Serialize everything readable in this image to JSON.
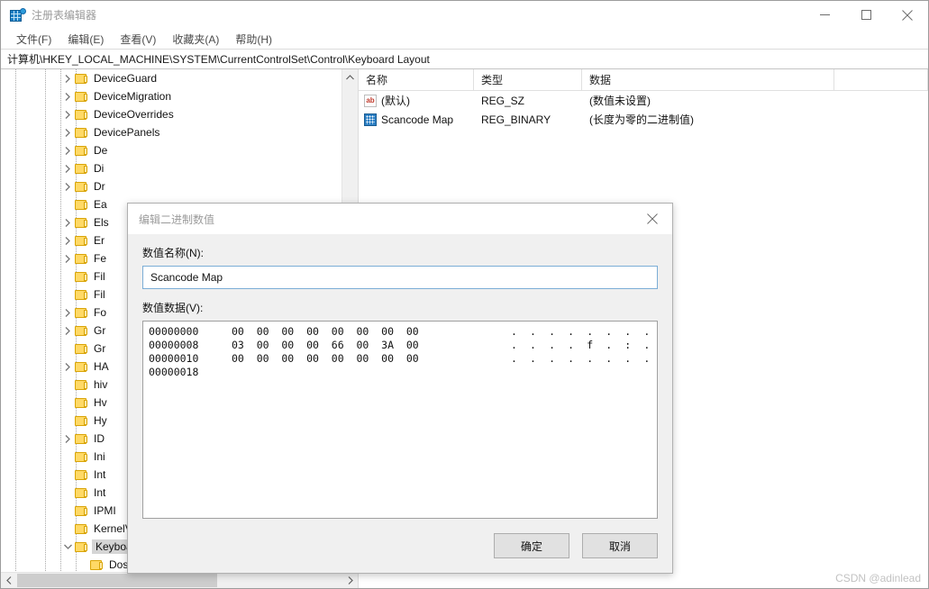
{
  "window": {
    "title": "注册表编辑器",
    "app_icon": "registry-editor-icon",
    "controls": {
      "minimize": "minimize-icon",
      "maximize": "maximize-icon",
      "close": "close-icon"
    }
  },
  "menu": {
    "items": [
      {
        "label": "文件(F)"
      },
      {
        "label": "编辑(E)"
      },
      {
        "label": "查看(V)"
      },
      {
        "label": "收藏夹(A)"
      },
      {
        "label": "帮助(H)"
      }
    ]
  },
  "address": {
    "path": "计算机\\HKEY_LOCAL_MACHINE\\SYSTEM\\CurrentControlSet\\Control\\Keyboard Layout"
  },
  "tree": {
    "items": [
      {
        "label": "DeviceGuard",
        "expandable": true,
        "expanded": false,
        "depth": 1,
        "selected": false
      },
      {
        "label": "DeviceMigration",
        "expandable": true,
        "expanded": false,
        "depth": 1,
        "selected": false
      },
      {
        "label": "DeviceOverrides",
        "expandable": true,
        "expanded": false,
        "depth": 1,
        "selected": false
      },
      {
        "label": "DevicePanels",
        "expandable": true,
        "expanded": false,
        "depth": 1,
        "selected": false
      },
      {
        "label": "De",
        "expandable": true,
        "expanded": false,
        "depth": 1,
        "selected": false
      },
      {
        "label": "Di",
        "expandable": true,
        "expanded": false,
        "depth": 1,
        "selected": false
      },
      {
        "label": "Dr",
        "expandable": true,
        "expanded": false,
        "depth": 1,
        "selected": false
      },
      {
        "label": "Ea",
        "expandable": false,
        "expanded": false,
        "depth": 1,
        "selected": false
      },
      {
        "label": "Els",
        "expandable": true,
        "expanded": false,
        "depth": 1,
        "selected": false
      },
      {
        "label": "Er",
        "expandable": true,
        "expanded": false,
        "depth": 1,
        "selected": false
      },
      {
        "label": "Fe",
        "expandable": true,
        "expanded": false,
        "depth": 1,
        "selected": false
      },
      {
        "label": "Fil",
        "expandable": false,
        "expanded": false,
        "depth": 1,
        "selected": false
      },
      {
        "label": "Fil",
        "expandable": false,
        "expanded": false,
        "depth": 1,
        "selected": false
      },
      {
        "label": "Fo",
        "expandable": true,
        "expanded": false,
        "depth": 1,
        "selected": false
      },
      {
        "label": "Gr",
        "expandable": true,
        "expanded": false,
        "depth": 1,
        "selected": false
      },
      {
        "label": "Gr",
        "expandable": false,
        "expanded": false,
        "depth": 1,
        "selected": false
      },
      {
        "label": "HA",
        "expandable": true,
        "expanded": false,
        "depth": 1,
        "selected": false
      },
      {
        "label": "hiv",
        "expandable": false,
        "expanded": false,
        "depth": 1,
        "selected": false
      },
      {
        "label": "Hv",
        "expandable": false,
        "expanded": false,
        "depth": 1,
        "selected": false
      },
      {
        "label": "Hy",
        "expandable": false,
        "expanded": false,
        "depth": 1,
        "selected": false
      },
      {
        "label": "ID",
        "expandable": true,
        "expanded": false,
        "depth": 1,
        "selected": false
      },
      {
        "label": "Ini",
        "expandable": false,
        "expanded": false,
        "depth": 1,
        "selected": false
      },
      {
        "label": "Int",
        "expandable": false,
        "expanded": false,
        "depth": 1,
        "selected": false
      },
      {
        "label": "Int",
        "expandable": false,
        "expanded": false,
        "depth": 1,
        "selected": false
      },
      {
        "label": "IPMI",
        "expandable": false,
        "expanded": false,
        "depth": 1,
        "selected": false
      },
      {
        "label": "KernelVelocity",
        "expandable": false,
        "expanded": false,
        "depth": 1,
        "selected": false
      },
      {
        "label": "Keyboard Layout",
        "expandable": true,
        "expanded": true,
        "depth": 1,
        "selected": true
      },
      {
        "label": "DosKeybCodes",
        "expandable": false,
        "expanded": false,
        "depth": 2,
        "selected": false
      }
    ]
  },
  "list": {
    "columns": [
      {
        "label": "名称"
      },
      {
        "label": "类型"
      },
      {
        "label": "数据"
      }
    ],
    "rows": [
      {
        "icon": "string-value-icon",
        "icon_kind": "sz",
        "icon_text": "ab",
        "name": "(默认)",
        "type": "REG_SZ",
        "data": "(数值未设置)"
      },
      {
        "icon": "binary-value-icon",
        "icon_kind": "bin",
        "icon_text": "",
        "name": "Scancode Map",
        "type": "REG_BINARY",
        "data": "(长度为零的二进制值)"
      }
    ]
  },
  "dialog": {
    "title": "编辑二进制数值",
    "close_icon": "close-icon",
    "value_name_label": "数值名称(N):",
    "value_name": "Scancode Map",
    "value_data_label": "数值数据(V):",
    "hex_lines": [
      {
        "offset": "00000000",
        "bytes": "00  00  00  00  00  00  00  00",
        "ascii": ". . . . . . . ."
      },
      {
        "offset": "00000008",
        "bytes": "03  00  00  00  66  00  3A  00",
        "ascii": ". . . . f . : ."
      },
      {
        "offset": "00000010",
        "bytes": "00  00  00  00  00  00  00  00",
        "ascii": ". . . . . . . ."
      },
      {
        "offset": "00000018",
        "bytes": "",
        "ascii": ""
      }
    ],
    "ok_label": "确定",
    "cancel_label": "取消"
  },
  "watermark": {
    "text": "CSDN @adinlead"
  }
}
